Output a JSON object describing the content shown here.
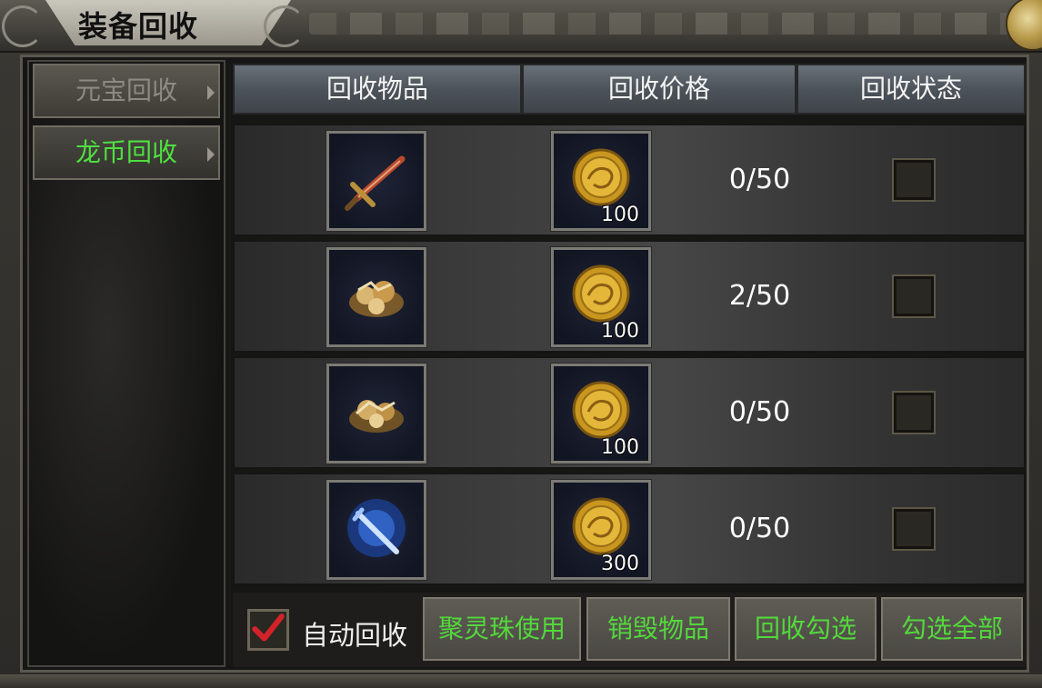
{
  "window": {
    "title": "装备回收"
  },
  "sidebar": {
    "tabs": [
      {
        "label": "元宝回收",
        "active": false
      },
      {
        "label": "龙币回收",
        "active": true
      }
    ]
  },
  "table": {
    "headers": [
      "回收物品",
      "回收价格",
      "回收状态"
    ],
    "rows": [
      {
        "item_icon": "sword-icon",
        "price": "100",
        "count": "0/50",
        "checked": false
      },
      {
        "item_icon": "treasure-pile-icon",
        "price": "100",
        "count": "2/50",
        "checked": false
      },
      {
        "item_icon": "treasure-pile-icon",
        "price": "100",
        "count": "0/50",
        "checked": false
      },
      {
        "item_icon": "blue-aura-sword-icon",
        "price": "300",
        "count": "0/50",
        "checked": false
      }
    ]
  },
  "footer": {
    "auto_recycle_label": "自动回收",
    "auto_recycle_checked": true,
    "buttons": [
      "聚灵珠使用",
      "销毁物品",
      "回收勾选",
      "勾选全部"
    ]
  },
  "colors": {
    "active_tab_text": "#4ee040",
    "button_text": "#53d83b",
    "check_mark": "#d3222a"
  },
  "icons": [
    "close-icon",
    "gold-coin-icon",
    "check-mark-icon"
  ]
}
